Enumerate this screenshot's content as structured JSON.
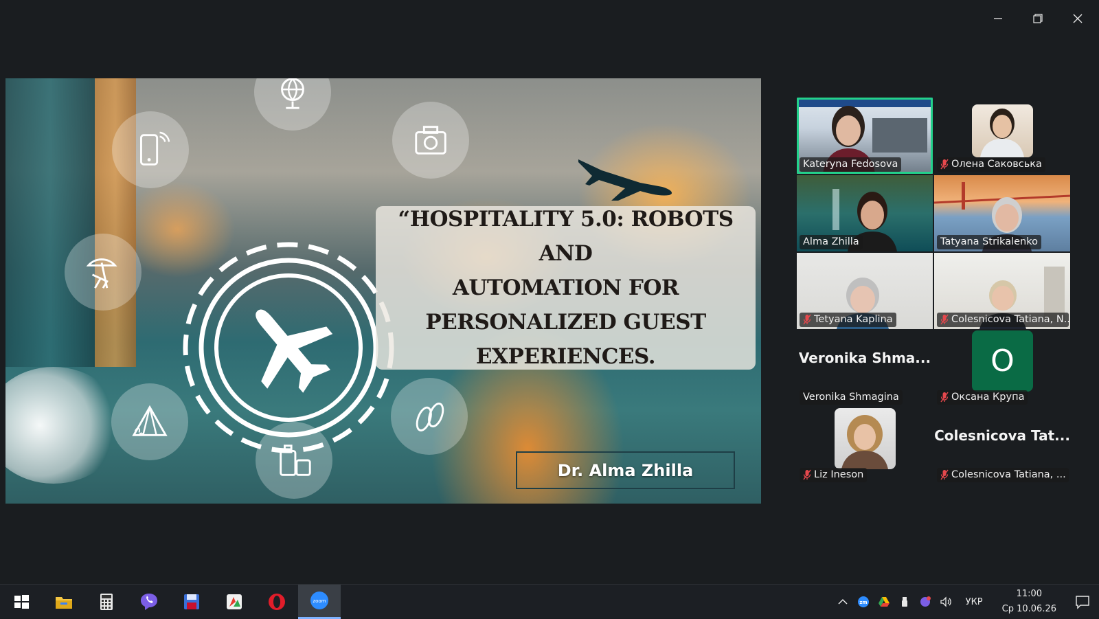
{
  "window": {
    "controls": [
      "minimize",
      "restore",
      "close"
    ]
  },
  "slide": {
    "title": "“HOSPITALITY 5.0: ROBOTS AND AUTOMATION FOR PERSONALIZED GUEST EXPERIENCES.",
    "title_lines": [
      "“HOSPITALITY 5.0: ROBOTS AND",
      "AUTOMATION FOR",
      "PERSONALIZED GUEST",
      "EXPERIENCES."
    ],
    "presenter": "Dr.  Alma Zhilla",
    "icons": [
      "globe-icon",
      "smartphone-icon",
      "camera-icon",
      "beach-chair-icon",
      "tent-icon",
      "flip-flops-icon",
      "luggage-icon",
      "airplane-icon",
      "hotel-icon"
    ]
  },
  "participants": [
    {
      "name": "Kateryna Fedosova",
      "muted": false,
      "active": true,
      "video": true
    },
    {
      "name": "Олена Саковська",
      "muted": true,
      "video": false,
      "avatar": true
    },
    {
      "name": "Alma Zhilla",
      "muted": false,
      "video": true
    },
    {
      "name": "Tatyana Strikalenko",
      "muted": false,
      "video": true
    },
    {
      "name": "Tetyana Kaplina",
      "muted": true,
      "video": true
    },
    {
      "name": "Colesnicova Tatiana, N...",
      "muted": true,
      "video": true
    },
    {
      "name": "Veronika Shmagina",
      "display": "Veronika Shma...",
      "muted": false,
      "video": false
    },
    {
      "name": "Оксана Крупа",
      "muted": true,
      "video": false,
      "initial": "O"
    },
    {
      "name": "Liz Ineson",
      "muted": true,
      "video": false,
      "avatar": true
    },
    {
      "name": "Colesnicova Tatiana, ...",
      "display": "Colesnicova  Tat...",
      "muted": true,
      "video": false
    }
  ],
  "taskbar": {
    "apps": [
      "start-icon",
      "file-explorer-icon",
      "calculator-icon",
      "viber-icon",
      "save-disk-icon",
      "media-app-icon",
      "opera-icon",
      "zoom-icon"
    ],
    "zoom_label": "zoom",
    "language": "УКР",
    "time": "11:00",
    "date": "Ср 10.06.26"
  },
  "colors": {
    "active_speaker": "#23d18b",
    "muted_icon": "#e5484d",
    "oksana_avatar": "#0a6b45"
  }
}
